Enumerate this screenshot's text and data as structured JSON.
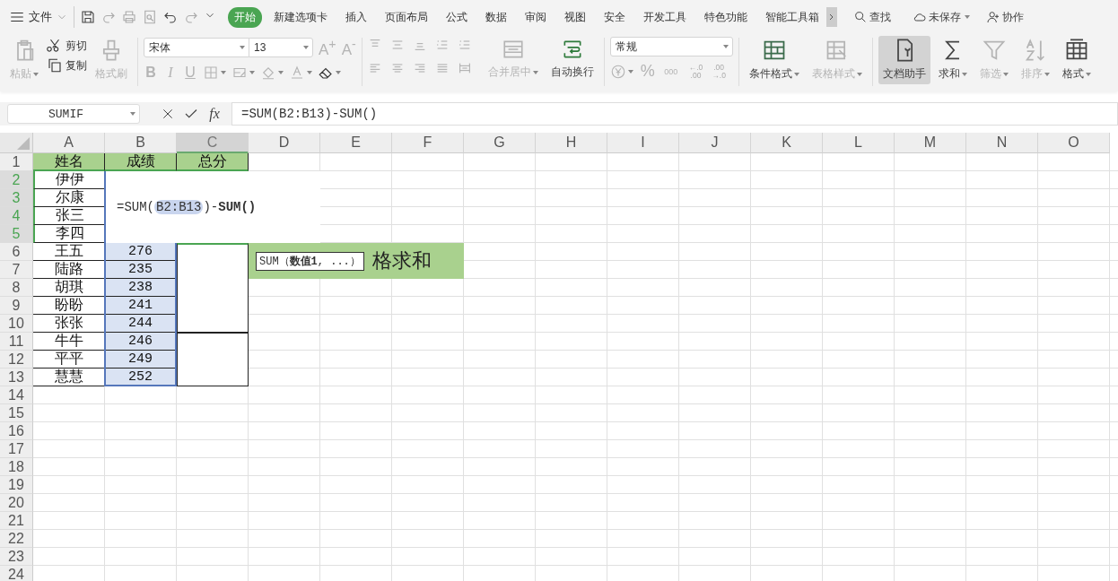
{
  "menu": {
    "label": "文件"
  },
  "tabs": [
    {
      "label": "开始",
      "selected": true
    },
    {
      "label": "新建选项卡",
      "selected": false
    },
    {
      "label": "插入",
      "selected": false
    },
    {
      "label": "页面布局",
      "selected": false
    },
    {
      "label": "公式",
      "selected": false
    },
    {
      "label": "数据",
      "selected": false
    },
    {
      "label": "审阅",
      "selected": false
    },
    {
      "label": "视图",
      "selected": false
    },
    {
      "label": "安全",
      "selected": false
    },
    {
      "label": "开发工具",
      "selected": false
    },
    {
      "label": "特色功能",
      "selected": false
    },
    {
      "label": "智能工具箱",
      "selected": false
    }
  ],
  "search": {
    "label": "查找"
  },
  "save_status": "未保存",
  "collab": "协作",
  "clipboard": [
    {
      "label": "粘贴",
      "disabled": true,
      "has_menu": true
    },
    {
      "label": "剪切",
      "disabled": false,
      "has_menu": false
    },
    {
      "label": "复制",
      "disabled": false,
      "has_menu": false
    },
    {
      "label": "格式刷",
      "disabled": true,
      "has_menu": false
    }
  ],
  "font": {
    "family": "宋体",
    "size": "13",
    "grow": "A$^{+}$",
    "shrink": "A$^{-}$",
    "styles": [
      "B",
      "I",
      "U"
    ]
  },
  "alignment": [
    {
      "label": "合并居中",
      "disabled": true,
      "has_menu": true
    },
    {
      "label": "自动换行",
      "disabled": false,
      "has_menu": false
    }
  ],
  "number": {
    "format": "常规",
    "percent": "%",
    "thousands": "000",
    "decimals": [
      {
        "top": "←.0",
        "bottom": ".00"
      },
      {
        "top": ".00",
        "bottom": "→.0"
      }
    ]
  },
  "styles": [
    {
      "label": "条件格式",
      "disabled": false,
      "has_menu": true
    },
    {
      "label": "表格样式",
      "disabled": true,
      "has_menu": true
    }
  ],
  "tools": [
    {
      "label": "文档助手",
      "disabled": false,
      "selected": true,
      "has_menu": false
    },
    {
      "label": "求和",
      "disabled": false,
      "selected": false,
      "has_menu": true
    },
    {
      "label": "筛选",
      "disabled": true,
      "selected": false,
      "has_menu": true
    },
    {
      "label": "排序",
      "disabled": true,
      "selected": false,
      "has_menu": true
    },
    {
      "label": "格式",
      "disabled": false,
      "selected": false,
      "has_menu": true
    }
  ],
  "formula_bar": {
    "name_box": "SUMIF",
    "fx": "fx",
    "formula": "=SUM(B2:B13)-SUM()"
  },
  "sheet": {
    "columns": [
      {
        "label": "A",
        "selected": false
      },
      {
        "label": "B",
        "selected": false
      },
      {
        "label": "C",
        "selected": true
      },
      {
        "label": "D",
        "selected": false
      },
      {
        "label": "E",
        "selected": false
      },
      {
        "label": "F",
        "selected": false
      },
      {
        "label": "G",
        "selected": false
      },
      {
        "label": "H",
        "selected": false
      },
      {
        "label": "I",
        "selected": false
      },
      {
        "label": "J",
        "selected": false
      },
      {
        "label": "K",
        "selected": false
      },
      {
        "label": "L",
        "selected": false
      },
      {
        "label": "M",
        "selected": false
      },
      {
        "label": "N",
        "selected": false
      },
      {
        "label": "O",
        "selected": false
      }
    ],
    "rows": [
      {
        "label": "1",
        "selected": false,
        "cells": [
          {
            "text": "姓名",
            "selected": false
          },
          {
            "text": "成绩",
            "selected": false
          },
          {
            "text": "总分",
            "selected": false
          }
        ]
      },
      {
        "label": "2",
        "selected": true,
        "cells": [
          {
            "text": "伊伊",
            "selected": false
          }
        ]
      },
      {
        "label": "3",
        "selected": true,
        "cells": [
          {
            "text": "尔康",
            "selected": false
          }
        ]
      },
      {
        "label": "4",
        "selected": true,
        "cells": [
          {
            "text": "张三",
            "selected": false
          }
        ]
      },
      {
        "label": "5",
        "selected": true,
        "cells": [
          {
            "text": "李四",
            "selected": false
          }
        ]
      },
      {
        "label": "6",
        "selected": false,
        "cells": [
          {
            "text": "王五",
            "selected": false
          },
          {
            "text": "276",
            "selected": true
          }
        ]
      },
      {
        "label": "7",
        "selected": false,
        "cells": [
          {
            "text": "陆路",
            "selected": false
          },
          {
            "text": "235",
            "selected": true
          }
        ]
      },
      {
        "label": "8",
        "selected": false,
        "cells": [
          {
            "text": "胡琪",
            "selected": false
          },
          {
            "text": "238",
            "selected": true
          }
        ]
      },
      {
        "label": "9",
        "selected": false,
        "cells": [
          {
            "text": "盼盼",
            "selected": false
          },
          {
            "text": "241",
            "selected": true
          }
        ]
      },
      {
        "label": "10",
        "selected": false,
        "cells": [
          {
            "text": "张张",
            "selected": false
          },
          {
            "text": "244",
            "selected": true
          }
        ]
      },
      {
        "label": "11",
        "selected": false,
        "cells": [
          {
            "text": "牛牛",
            "selected": false
          },
          {
            "text": "246",
            "selected": true
          }
        ]
      },
      {
        "label": "12",
        "selected": false,
        "cells": [
          {
            "text": "平平",
            "selected": false
          },
          {
            "text": "249",
            "selected": true
          }
        ]
      },
      {
        "label": "13",
        "selected": false,
        "cells": [
          {
            "text": "慧慧",
            "selected": false
          },
          {
            "text": "252",
            "selected": true
          }
        ]
      },
      {
        "label": "14",
        "selected": false
      },
      {
        "label": "15",
        "selected": false
      },
      {
        "label": "16",
        "selected": false
      },
      {
        "label": "17",
        "selected": false
      },
      {
        "label": "18",
        "selected": false
      },
      {
        "label": "19",
        "selected": false
      },
      {
        "label": "20",
        "selected": false
      },
      {
        "label": "21",
        "selected": false
      },
      {
        "label": "22",
        "selected": false
      },
      {
        "label": "23",
        "selected": false
      },
      {
        "label": "24",
        "selected": false
      }
    ],
    "editor": {
      "prefix": "=SUM(",
      "reference": "B2:B13",
      "suffix": ")-**SUM()**"
    },
    "tooltip": "SUM（**数值1**, ...）",
    "banner": "格求和"
  }
}
